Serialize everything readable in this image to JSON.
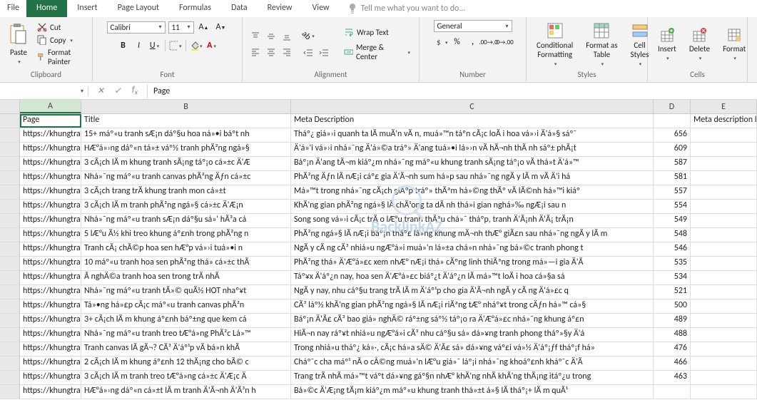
{
  "tabs": {
    "file": "File",
    "home": "Home",
    "insert": "Insert",
    "page_layout": "Page Layout",
    "formulas": "Formulas",
    "data": "Data",
    "review": "Review",
    "view": "View"
  },
  "tell_me": "Tell me what you want to do...",
  "clipboard": {
    "group": "Clipboard",
    "paste": "Paste",
    "cut": "Cut",
    "copy": "Copy",
    "fp": "Format Painter"
  },
  "font": {
    "group": "Font",
    "name": "Calibri",
    "size": "11"
  },
  "alignment": {
    "group": "Alignment",
    "wrap": "Wrap Text",
    "merge": "Merge & Center"
  },
  "number": {
    "group": "Number",
    "format": "General"
  },
  "styles": {
    "group": "Styles",
    "cond": "Conditional\nFormatting",
    "table": "Format as\nTable",
    "cell": "Cell\nStyles"
  },
  "cells": {
    "group": "Cells",
    "insert": "Insert",
    "delete": "Delete",
    "format": "Format"
  },
  "namebox": "",
  "formula": "Page",
  "watermark": "BacklinkAZ",
  "columns": [
    "A",
    "B",
    "C",
    "D",
    "E"
  ],
  "chart_data": null,
  "rows": [
    {
      "a": "Page",
      "b": "Title",
      "c": "Meta Description",
      "d": "",
      "e": "Meta description length"
    },
    {
      "a": "https://khungtran",
      "b": "15+ máº«u tranh sÆ¡n dáº§u hoa ná»•i báº­t nh",
      "c": "Tháº¿ giá»›i quanh ta lÃ  muÃ'n vÃ n, muá»™n táº­n cÃ¡c loÃ i hoa vá»›i Ä'á»§ sáº¯",
      "d": "656",
      "e": ""
    },
    {
      "a": "https://khungtran",
      "b": "HÆ°á»›ng dáº«n tá»± váº½ tranh phÃ²ng ngá»§",
      "c": "Ä'á»'i vá»›i nhá»¯ng Ä'á»©a tráº» Ä'ang tuá»•i lá»›n vÃ  hÃ¬nh thÃ nh sáº± phÃ¡t",
      "d": "609",
      "e": ""
    },
    {
      "a": "https://khungtran",
      "b": "3 cÃ¡ch lÃ m khung tranh sÃ¡ng táº¡o cá»±c Ä'Æ",
      "c": "Báº¡n Ä'ang tÃ¬m kiáº¿m nhá»¯ng máº«u khung tranh sÃ¡ng táº¡o vÃ  thá»­t Ä'á»™",
      "d": "587",
      "e": ""
    },
    {
      "a": "https://khungtran",
      "b": "Nhá»¯ng máº«u tranh canvas phÃ²ng Äƒn cá»±c",
      "c": "PhÃ²ng Äƒn lÃ  nÆ¡i cáº£ gia Ä'Ã¬nh sum há»p sau nhá»¯ng ngÃ y lÃ m vÃ  Ä'i há",
      "d": "581",
      "e": ""
    },
    {
      "a": "https://khungtran",
      "b": "3 cÃ¡ch trang trÃ­ khung tranh mon cá»±t",
      "c": "Má»™t trong nhá»¯ng cÃ¡ch giÃºp tráº» thÃªm há»©ng thÃº vÃ  lÃ©nh há»™i kiáº",
      "d": "557",
      "e": ""
    },
    {
      "a": "https://khungtran",
      "b": "3 cÃ¡ch lÃ m tranh phÃ²ng ngá»§ cá»±c Ä'Æ¡n",
      "c": "KhÃ'ng gian phÃ²ng ngá»§ lÃ  chÃ¹ong ta dÃ nh thá»i gian nghá»‰ ngÆ¡i sau n",
      "d": "554",
      "e": ""
    },
    {
      "a": "https://khungtran",
      "b": "Nhá»¯ng máº«u tranh sÆ¡n dáº§u sá»' hÃ³a cá",
      "c": "Song song vá»›i cÃ¡c trÃ o lÆ°u tranh thÃªu chá»¯ tháº­p, tranh Ä'Ã¡­nh Ä'Ã¡ trÃ¡­n",
      "d": "549",
      "e": ""
    },
    {
      "a": "https://khungtran",
      "b": "5 lÆ°u Ã½ khi treo khung áº£nh trong phÃ²ng n",
      "c": "PhÃ²ng ngá»§ lÃ  nÆ¡i báº¡n tháº£ lá»ng khung mÄ¬nh thÆ° giÃ£n sau nhá»¯ng ngÃ y lÃ m",
      "d": "548",
      "e": ""
    },
    {
      "a": "https://khungtran",
      "b": "Tranh cÃ¡ chÃ©p hoa sen hÆ°p vá»›i tuá»•i n",
      "c": "NgÃ y cÃ ng cÃ³ nhiá»u ngÆ°á»i muá»'n lá»±a chá»n nhá»¯ng bá»©c tranh phong t",
      "d": "546",
      "e": ""
    },
    {
      "a": "https://khungtran",
      "b": "10 máº«u tranh hoa sen phÃ²ng thá» cá»±c thÃ",
      "c": "PhÃ²ng thá» Ä'Æ°á»£c xem nhÆ° nÆ¡i thá» cÃºng linh thiÃªng trong má»—i gia Ä'Ã",
      "d": "535",
      "e": ""
    },
    {
      "a": "https://khungtran",
      "b": "Ã nghÄ©a tranh hoa sen trong trÃ­ nhÃ",
      "c": "Táº¥x Ä'áº¿n nay, hoa sen Ä'Æ°á»£c biáº¿t Ä'áº¿n lÃ  má»™t loÃ i hoa cá»§a sá",
      "d": "534",
      "e": ""
    },
    {
      "a": "https://khungtran",
      "b": "Nhá»¯ng máº«u tranh tÃ»© quÃ½ HOT nhaº¥t",
      "c": "NgÃ y nay, nhu cáº§u trang trÃ­ lÃ m Ä'áº¹p cho gia Ä'Ã¬nh ngÃ y cÃ ng Ä'á»£c q",
      "d": "521",
      "e": ""
    },
    {
      "a": "https://khungtran",
      "b": "Tá»•ng há»£p cÃ¡c máº«u tranh canvas phÃ²n",
      "c": "CÃ³ láº½ khÃ'ng gian phÃ²ng ngá»§ lÃ  nÆ¡i riÃªng tÆ° nháº¥t trong cÄƒn há»™ cá»§",
      "d": "500",
      "e": ""
    },
    {
      "a": "https://khungtran",
      "b": "3+ cÃ¡ch lÃ m khung áº£nh báº±ng que kem cá",
      "c": "Báº¡n Ä'Ã£ cÃ³ bao giá» nghÄ© ráº±ng sáº½ táº¡o ra Ä'Æ°á»£c nhá»¯ng khung áº£n",
      "d": "489",
      "e": ""
    },
    {
      "a": "https://khungtran",
      "b": "Nhá»¯ng máº«u tranh treo tÆ°á»ng PhÃ²c Lá»™",
      "c": "HiÃ¬n nay ráº¥t nhiá»u ngÆ°á»i cÃ³ nhu cáº§u sá»­ dá»¥ng tranh phong tháº»§y Ä'á",
      "d": "488",
      "e": ""
    },
    {
      "a": "https://khungtran",
      "b": "Tranh canvas lÃ  gÃ¬­? CÃ³ Ä'áº¹p vÃ  bá»n khÃ",
      "c": "Trong nhiá»u tháº¿ ká»·, cÃ¡c há»a sÄ© Ä'Ã£ sá»­ dá»¥ng váº£i vá»½ Ä'áº¡ƒf tháº¡f há»",
      "d": "476",
      "e": ""
    },
    {
      "a": "https://khungtran",
      "b": "2 cÃ¡ch lÃ m khung áº£nh 12 thÃ¡ng cho bÃ© c",
      "c": "Cháº¯c cha máº¹ nÃ o cÅ©ng muá»'n lÆ°u giá»¯ láº¡i nhá»¯ng khoáº£nh kháº¯c Ä'Ã",
      "d": "466",
      "e": ""
    },
    {
      "a": "https://khungtran",
      "b": "3 cÃ¡ch lÃ m tranh treo tÆ°á»ng cá»±c Ä'Æ¡c Ä",
      "c": "Trang trÃ­ nhÃ  má»™t váº­t dá»¥ng gáº§n nhÆ° khÃ'ng nhÃ  khÃ'ng thÃ¡ng itáº¿u trong",
      "d": "463",
      "e": ""
    },
    {
      "a": "https://khungtran",
      "b": "HÆ°á»›ng dáº«n cá»±t lÃ m tranh Ä'Ã¬nh Ä'Ã³n h",
      "c": "Bá»©c Ä'Æ¡ng tÃ¡m kiáº¿m máº«u khung tranh thá»±t á»§ lÃ tháº¡+ lÃ m quÃ¹",
      "d": "",
      "e": ""
    }
  ]
}
